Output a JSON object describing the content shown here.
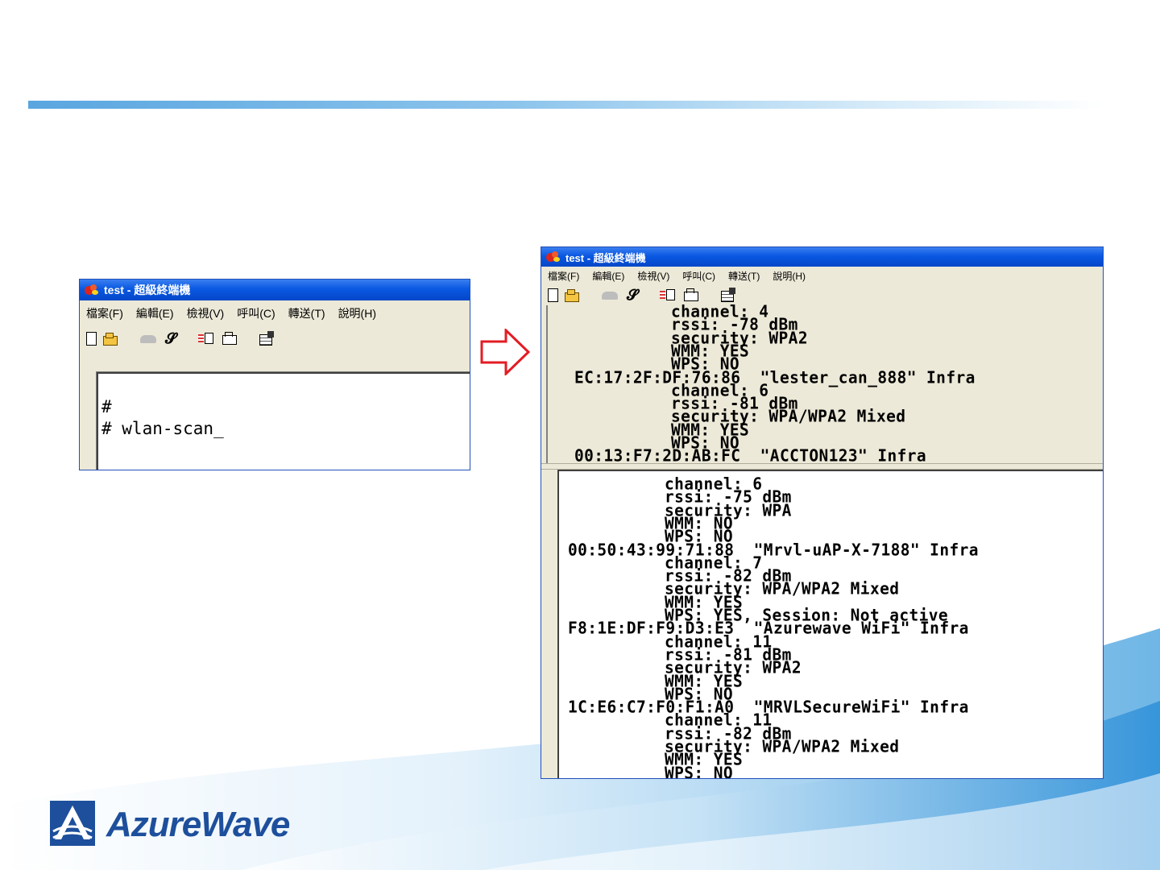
{
  "slide": {
    "brand_name": "AzureWave",
    "colors": {
      "accent_blue": "#5aa6e0",
      "logo_blue": "#1d4f9c",
      "arrow_red": "#e31c23",
      "window_title_blue": "#0a58e2"
    }
  },
  "small_window": {
    "title": "test - 超級終端機",
    "menu": [
      "檔案(F)",
      "編輯(E)",
      "檢視(V)",
      "呼叫(C)",
      "轉送(T)",
      "說明(H)"
    ],
    "toolbar_icons": [
      "new-icon",
      "open-icon",
      "dial-icon",
      "hang-up-icon",
      "send-icon",
      "receive-icon",
      "properties-icon"
    ],
    "terminal_lines": [
      "#",
      "# wlan-scan_"
    ]
  },
  "arrow": {
    "icon": "right-arrow-icon"
  },
  "big_window": {
    "title": "test - 超級終端機",
    "menu": [
      "檔案(F)",
      "編輯(E)",
      "檢視(V)",
      "呼叫(C)",
      "轉送(T)",
      "說明(H)"
    ],
    "toolbar_icons": [
      "new-icon",
      "open-icon",
      "dial-icon",
      "hang-up-icon",
      "send-icon",
      "receive-icon",
      "properties-icon"
    ],
    "upper_lines": [
      "channel: 4",
      "rssi: -78 dBm",
      "security: WPA2",
      "WMM: YES",
      "WPS: NO",
      "EC:17:2F:DF:76:86  \"lester_can_888\" Infra",
      "channel: 6",
      "rssi: -81 dBm",
      "security: WPA/WPA2 Mixed",
      "WMM: YES",
      "WPS: NO",
      "00:13:F7:2D:AB:FC  \"ACCTON123\" Infra"
    ],
    "lower_lines": [
      "channel: 6",
      "rssi: -75 dBm",
      "security: WPA",
      "WMM: NO",
      "WPS: NO",
      "00:50:43:99:71:88  \"Mrvl-uAP-X-7188\" Infra",
      "channel: 7",
      "rssi: -82 dBm",
      "security: WPA/WPA2 Mixed",
      "WMM: YES",
      "WPS: YES, Session: Not active",
      "F8:1E:DF:F9:D3:E3  \"Azurewave WiFi\" Infra",
      "channel: 11",
      "rssi: -81 dBm",
      "security: WPA2",
      "WMM: YES",
      "WPS: NO",
      "1C:E6:C7:F0:F1:A0  \"MRVLSecureWiFi\" Infra",
      "channel: 11",
      "rssi: -82 dBm",
      "security: WPA/WPA2 Mixed",
      "WMM: YES",
      "WPS: NO"
    ]
  }
}
